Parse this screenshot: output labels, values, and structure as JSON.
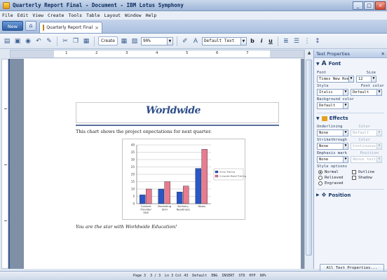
{
  "window": {
    "title": "Quarterly Report Final - Document - IBM Lotus Symphony",
    "minimize": "_",
    "maximize": "□",
    "close": "×"
  },
  "menu": [
    "File",
    "Edit",
    "View",
    "Create",
    "Tools",
    "Table",
    "Layout",
    "Window",
    "Help"
  ],
  "tabs": {
    "new_label": "New",
    "active_tab": "Quarterly Report Final",
    "close": "×"
  },
  "toolbar": {
    "create_label": "Create",
    "zoom_value": "90%",
    "style_value": "Default Text",
    "bold": "b",
    "italic": "i",
    "underline": "u"
  },
  "ruler": {
    "numbers": [
      "1",
      "2",
      "3",
      "4",
      "5",
      "6",
      "7"
    ]
  },
  "document": {
    "logo_text": "Worldwide",
    "chart_caption": "This chart shows the project expectations for next quarter.",
    "closing_text": "You are the star with Worldwide Education!"
  },
  "chart_data": {
    "type": "bar",
    "categories": [
      "Content Provider Skill",
      "Marketing Skill",
      "Delivery Readiness",
      "Totals"
    ],
    "series": [
      {
        "name": "Group Training",
        "color": "#2a56c6",
        "values": [
          6,
          10,
          8,
          24
        ]
      },
      {
        "name": "Computer Based Training",
        "color": "#e87b8e",
        "values": [
          10,
          15,
          12,
          37
        ]
      }
    ],
    "ylim": [
      0,
      40
    ],
    "yticks": [
      "0",
      "5",
      "10",
      "15",
      "20",
      "25",
      "30",
      "35",
      "40"
    ],
    "legend": "right"
  },
  "panel": {
    "title": "Text Properties",
    "font_section": "Font",
    "font_label": "Font",
    "size_label": "Size",
    "font_value": "Times New Roma",
    "size_value": "12",
    "style_label": "Style",
    "font_color_label": "Font color",
    "style_value": "Italic",
    "font_color_value": "Default",
    "bg_color_label": "Background color",
    "bg_color_value": "Default",
    "effects_section": "Effects",
    "underlining_label": "Underlining",
    "ul_color_label": "Color",
    "underlining_value": "None",
    "ul_color_value": "Default",
    "strike_label": "Strikethrough",
    "strike_color_label": "Color",
    "strike_value": "None",
    "strike_color_value": "Continuous",
    "emph_label": "Emphasis mark",
    "position_label": "Position",
    "emph_value": "None",
    "emph_pos_value": "Above text",
    "style_options_label": "Style options",
    "opt_normal": "Normal",
    "opt_outline": "Outline",
    "opt_relieved": "Relieved",
    "opt_shadow": "Shadow",
    "opt_engraved": "Engraved",
    "position_section": "Position",
    "all_props_button": "All Text Properties..."
  },
  "status": {
    "page": "Page 3",
    "pages": "3 / 3",
    "cursor": "Ln 3 Col 43",
    "style": "Default",
    "lang": "ENG",
    "insert": "INSERT",
    "std": "STD",
    "hyp": "HYP",
    "zoom": "90%"
  }
}
